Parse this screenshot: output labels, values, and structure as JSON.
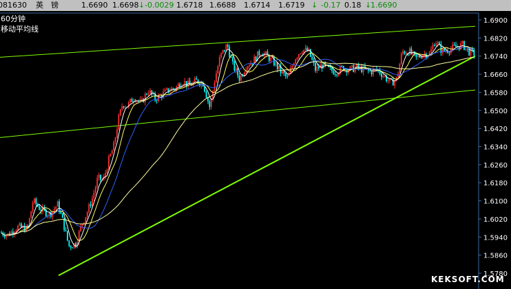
{
  "quote_bar": {
    "code": "081630",
    "name": "英　镑",
    "last": "1.6690",
    "prev": "1.6698",
    "change": "-0.0029",
    "open": "1.6718",
    "low": "1.6688",
    "high": "1.6714",
    "close2": "1.6719",
    "change_pct": "-0.17",
    "amplitude": "0.18",
    "bid": "1.6690",
    "arrow": "↓"
  },
  "period_label": "60分钟",
  "indicator_label": "移动平均线",
  "watermark": "KEKSOFT.COM",
  "colors": {
    "up": "#ff3030",
    "down": "#00ffff",
    "ma_fast": "#ffffff",
    "ma_mid": "#ffff66",
    "ma_slow": "#3060ff",
    "ma_long": "#ffffa0",
    "trend": "#7fff00",
    "axis": "#3a6ea5"
  },
  "chart_data": {
    "type": "candlestick",
    "y_ticks": [
      "1.6900",
      "1.6820",
      "1.6740",
      "1.6660",
      "1.6580",
      "1.6500",
      "1.6420",
      "1.6340",
      "1.6260",
      "1.6180",
      "1.6100",
      "1.6020",
      "1.5940",
      "1.5860",
      "1.5780"
    ],
    "ylim": [
      1.578,
      1.69
    ],
    "price_path": [
      [
        0,
        1.596
      ],
      [
        12,
        1.595
      ],
      [
        25,
        1.5985
      ],
      [
        40,
        1.5975
      ],
      [
        48,
        1.61
      ],
      [
        60,
        1.606
      ],
      [
        72,
        1.604
      ],
      [
        84,
        1.6085
      ],
      [
        92,
        1.6
      ],
      [
        100,
        1.59
      ],
      [
        110,
        1.591
      ],
      [
        118,
        1.599
      ],
      [
        128,
        1.606
      ],
      [
        135,
        1.612
      ],
      [
        142,
        1.62
      ],
      [
        150,
        1.619
      ],
      [
        158,
        1.628
      ],
      [
        165,
        1.634
      ],
      [
        172,
        1.646
      ],
      [
        178,
        1.653
      ],
      [
        185,
        1.652
      ],
      [
        195,
        1.656
      ],
      [
        205,
        1.653
      ],
      [
        215,
        1.659
      ],
      [
        225,
        1.655
      ],
      [
        235,
        1.657
      ],
      [
        245,
        1.659
      ],
      [
        255,
        1.66
      ],
      [
        265,
        1.663
      ],
      [
        275,
        1.661
      ],
      [
        285,
        1.663
      ],
      [
        295,
        1.662
      ],
      [
        305,
        1.651
      ],
      [
        312,
        1.664
      ],
      [
        320,
        1.674
      ],
      [
        330,
        1.679
      ],
      [
        338,
        1.67
      ],
      [
        348,
        1.664
      ],
      [
        358,
        1.67
      ],
      [
        368,
        1.672
      ],
      [
        378,
        1.676
      ],
      [
        388,
        1.674
      ],
      [
        398,
        1.671
      ],
      [
        408,
        1.667
      ],
      [
        418,
        1.664
      ],
      [
        428,
        1.673
      ],
      [
        438,
        1.677
      ],
      [
        448,
        1.676
      ],
      [
        458,
        1.668
      ],
      [
        468,
        1.67
      ],
      [
        478,
        1.668
      ],
      [
        488,
        1.667
      ],
      [
        498,
        1.669
      ],
      [
        508,
        1.668
      ],
      [
        518,
        1.669
      ],
      [
        528,
        1.668
      ],
      [
        538,
        1.667
      ],
      [
        548,
        1.668
      ],
      [
        558,
        1.665
      ],
      [
        568,
        1.662
      ],
      [
        576,
        1.664
      ],
      [
        584,
        1.676
      ],
      [
        594,
        1.676
      ],
      [
        604,
        1.673
      ],
      [
        614,
        1.675
      ],
      [
        624,
        1.675
      ],
      [
        632,
        1.681
      ],
      [
        642,
        1.676
      ],
      [
        652,
        1.677
      ],
      [
        662,
        1.678
      ],
      [
        672,
        1.679
      ],
      [
        680,
        1.676
      ],
      [
        690,
        1.675
      ]
    ]
  }
}
